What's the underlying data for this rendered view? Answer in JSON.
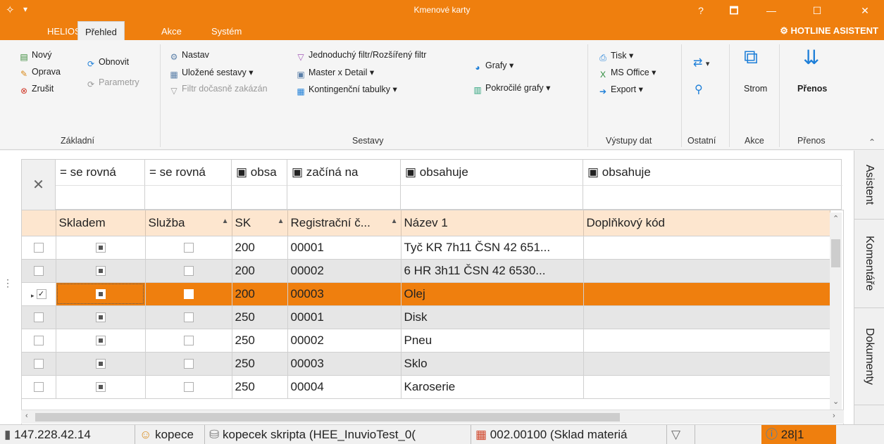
{
  "window": {
    "title": "Kmenové karty",
    "help": "?",
    "restore": "🗖",
    "minimize": "—",
    "maximize": "☐",
    "close": "✕"
  },
  "menu": {
    "tabs": [
      "HELIOS",
      "Přehled",
      "Akce",
      "Systém"
    ],
    "active": "Přehled",
    "hotline": "⚙ HOTLINE ASISTENT"
  },
  "ribbon": {
    "zakladni": {
      "label": "Základní",
      "novy": "Nový",
      "oprava": "Oprava",
      "zrusit": "Zrušit",
      "obnovit": "Obnovit",
      "parametry": "Parametry"
    },
    "sestavy": {
      "label": "Sestavy",
      "nastav": "Nastav",
      "ulozene": "Uložené sestavy",
      "filtr_dis": "Filtr dočasně zakázán",
      "jednoduchy": "Jednoduchý filtr/Rozšířený filtr",
      "master": "Master x Detail",
      "kontingencni": "Kontingenční tabulky",
      "grafy": "Grafy",
      "pokrocile": "Pokročilé grafy"
    },
    "vystupy": {
      "label": "Výstupy dat",
      "tisk": "Tisk",
      "msoffice": "MS Office",
      "export": "Export"
    },
    "ostatni": {
      "label": "Ostatní"
    },
    "akce": {
      "label": "Akce",
      "strom": "Strom"
    },
    "prenos": {
      "label": "Přenos",
      "prenos": "Přenos"
    }
  },
  "filters": [
    "= se rovná",
    "= se rovná",
    "▣ obsa",
    "▣ začíná na",
    "▣ obsahuje",
    "▣ obsahuje"
  ],
  "grid": {
    "headers": [
      "Skladem",
      "Služba",
      "SK",
      "Registrační č...",
      "Název 1",
      "Doplňkový kód"
    ],
    "rows": [
      {
        "sk": "200",
        "reg": "00001",
        "nazev": "Tyč KR 7h11 ČSN 42 651..."
      },
      {
        "sk": "200",
        "reg": "00002",
        "nazev": "6 HR 3h11 ČSN 42 6530..."
      },
      {
        "sk": "200",
        "reg": "00003",
        "nazev": "Olej"
      },
      {
        "sk": "250",
        "reg": "00001",
        "nazev": "Disk"
      },
      {
        "sk": "250",
        "reg": "00002",
        "nazev": "Pneu"
      },
      {
        "sk": "250",
        "reg": "00003",
        "nazev": "Sklo"
      },
      {
        "sk": "250",
        "reg": "00004",
        "nazev": "Karoserie"
      }
    ]
  },
  "sidepanel": [
    "Asistent",
    "Komentáře",
    "Dokumenty"
  ],
  "status": {
    "ip": "147.228.42.14",
    "user": "kopece",
    "db": "kopecek skripta (HEE_InuvioTest_0(",
    "sklad": "002.00100 (Sklad materiá",
    "count": "28|1"
  },
  "colors": {
    "accent": "#ef7f0e",
    "header_bg": "#fde6cf"
  }
}
